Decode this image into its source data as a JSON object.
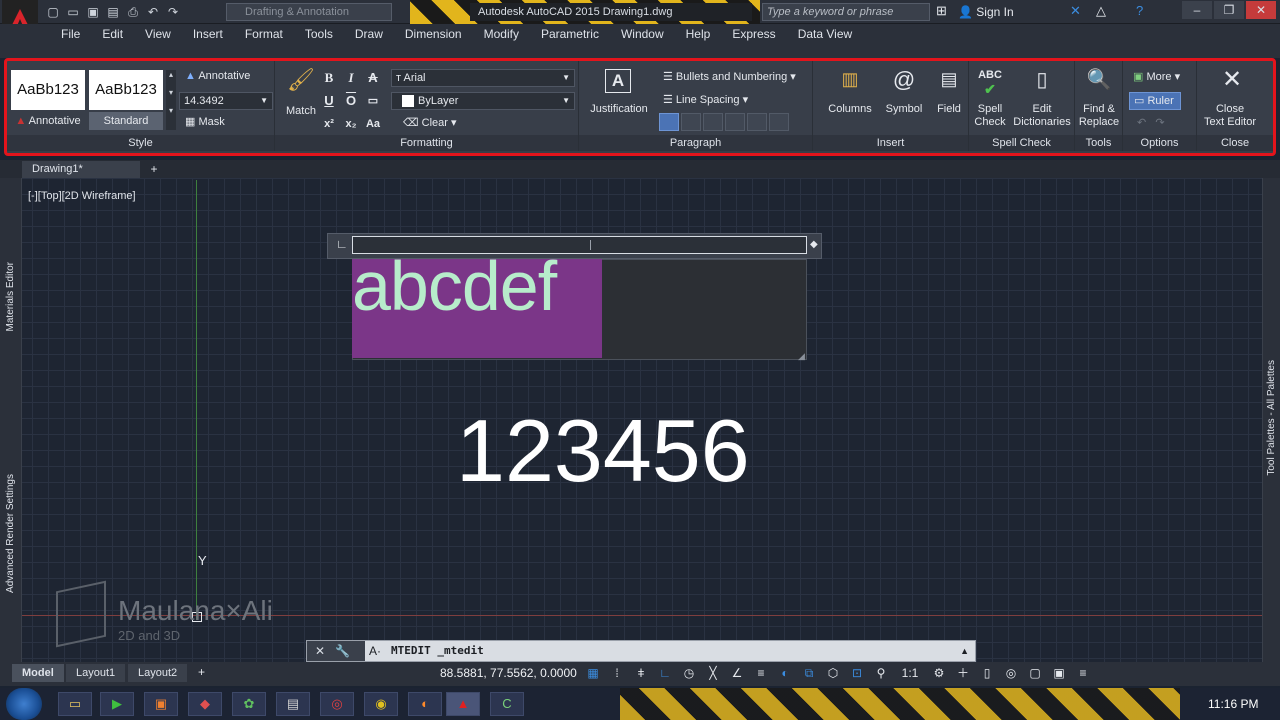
{
  "titlebar": {
    "workspace": "Drafting & Annotation",
    "app_title": "Autodesk AutoCAD 2015    Drawing1.dwg",
    "search_placeholder": "Type a keyword or phrase",
    "signin": "Sign In"
  },
  "menu": [
    "File",
    "Edit",
    "View",
    "Insert",
    "Format",
    "Tools",
    "Draw",
    "Dimension",
    "Modify",
    "Parametric",
    "Window",
    "Help",
    "Express",
    "Data View"
  ],
  "ribbon": {
    "style": {
      "title": "Style",
      "sample1": "AaBb123",
      "sample1_label": "Annotative",
      "sample2": "AaBb123",
      "sample2_label": "Standard",
      "annotative": "Annotative",
      "height": "14.3492",
      "mask": "Mask"
    },
    "formatting": {
      "title": "Formatting",
      "match": "Match",
      "font": "Arial",
      "color": "ByLayer",
      "clear": "Clear",
      "bold": "B",
      "italic": "I",
      "strike": "A",
      "underline": "U",
      "overline": "O"
    },
    "paragraph": {
      "title": "Paragraph",
      "justification": "Justification",
      "bullets": "Bullets and Numbering",
      "line_spacing": "Line Spacing"
    },
    "insert": {
      "title": "Insert",
      "columns": "Columns",
      "symbol": "Symbol",
      "field": "Field"
    },
    "spell": {
      "title": "Spell Check",
      "spell1": "Spell",
      "spell2": "Check",
      "edit1": "Edit",
      "edit2": "Dictionaries"
    },
    "tools": {
      "title": "Tools",
      "find1": "Find &",
      "find2": "Replace"
    },
    "options": {
      "title": "Options",
      "more": "More",
      "ruler": "Ruler"
    },
    "close": {
      "title": "Close",
      "close1": "Close",
      "close2": "Text Editor"
    }
  },
  "document": {
    "tab": "Drawing1*",
    "view_label": "[-][Top][2D Wireframe]"
  },
  "palettes": {
    "left1": "Materials Editor",
    "left2": "Advanced Render Settings",
    "right": "Tool Palettes - All Palettes"
  },
  "canvas": {
    "edited_text": "abcdef",
    "number_text": "123456",
    "ucs_y": "Y"
  },
  "watermark": {
    "name": "Maulana×Ali",
    "sub": "2D and 3D"
  },
  "command": {
    "text": "MTEDIT _mtedit"
  },
  "layouts": [
    "Model",
    "Layout1",
    "Layout2"
  ],
  "status": {
    "coords": "88.5881, 77.5562, 0.0000",
    "scale": "1:1"
  },
  "taskbar": {
    "time": "11:16 PM"
  }
}
